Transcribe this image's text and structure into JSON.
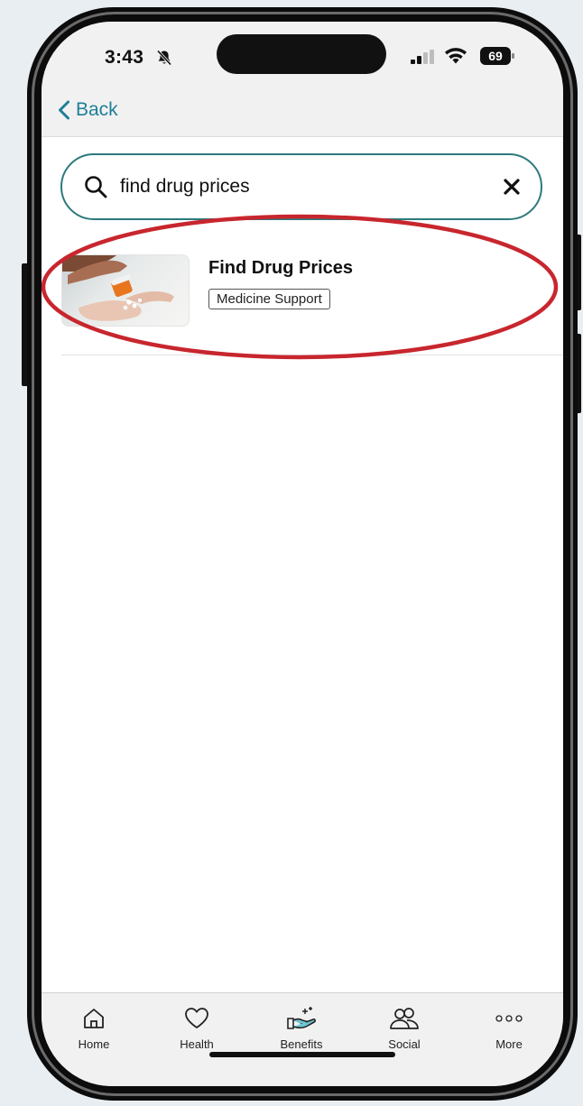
{
  "status_bar": {
    "time": "3:43",
    "battery": "69"
  },
  "nav": {
    "back_label": "Back"
  },
  "search": {
    "value": "find drug prices",
    "placeholder": ""
  },
  "results": [
    {
      "title": "Find Drug Prices",
      "tag": "Medicine Support",
      "image": "pills-pouring-into-hand"
    }
  ],
  "bottom_nav": {
    "items": [
      {
        "label": "Home",
        "icon": "home-icon"
      },
      {
        "label": "Health",
        "icon": "heart-icon"
      },
      {
        "label": "Benefits",
        "icon": "benefits-hand-icon"
      },
      {
        "label": "Social",
        "icon": "people-icon"
      },
      {
        "label": "More",
        "icon": "more-dots-icon"
      }
    ]
  },
  "colors": {
    "accent": "#1e7f97",
    "search_border": "#2c7a7d",
    "highlight": "#c8262e"
  }
}
